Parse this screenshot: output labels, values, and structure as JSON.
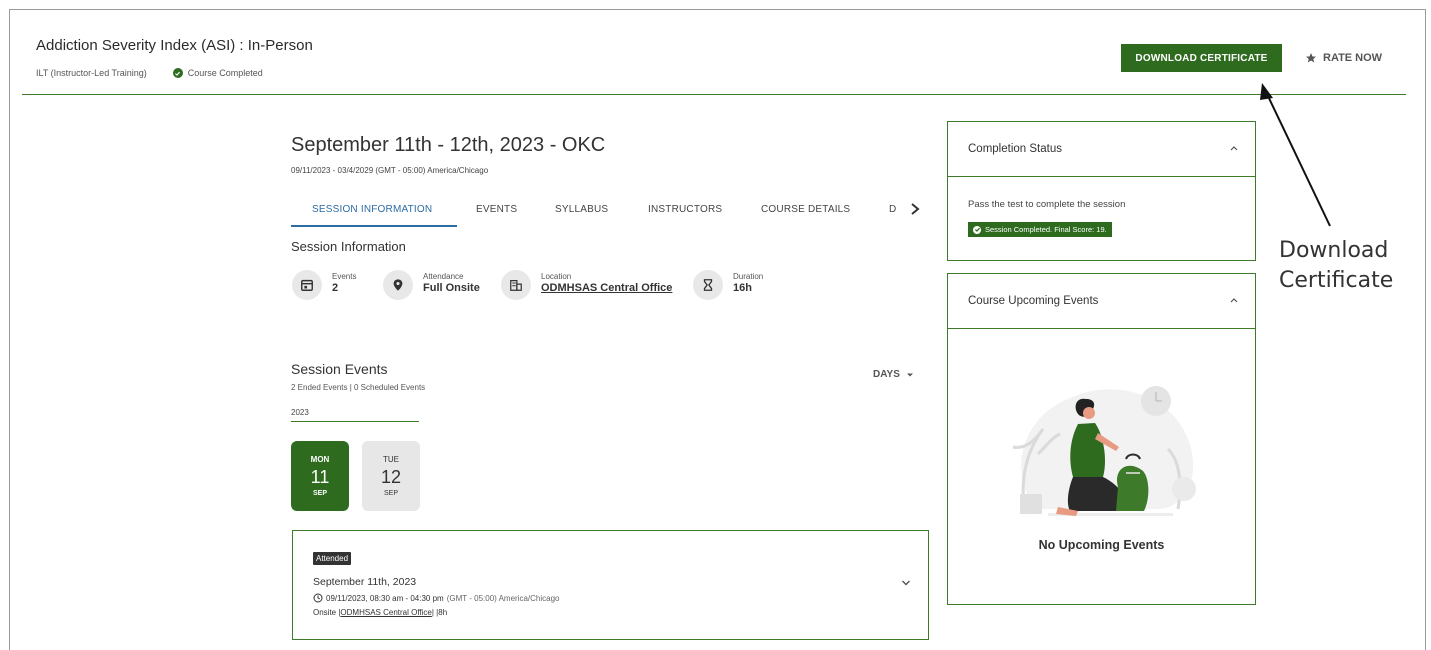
{
  "header": {
    "title": "Addiction Severity Index (ASI) : In-Person",
    "type": "ILT (Instructor-Led Training)",
    "status": "Course Completed",
    "download_label": "DOWNLOAD CERTIFICATE",
    "rate_label": "RATE NOW"
  },
  "annotation": {
    "line1": "Download",
    "line2": "Certificate"
  },
  "session": {
    "title": "September 11th - 12th, 2023 - OKC",
    "dates": "09/11/2023 - 03/4/2029 (GMT - 05:00) America/Chicago",
    "tabs": [
      {
        "label": "SESSION INFORMATION"
      },
      {
        "label": "EVENTS"
      },
      {
        "label": "SYLLABUS"
      },
      {
        "label": "INSTRUCTORS"
      },
      {
        "label": "COURSE DETAILS"
      },
      {
        "label": "D"
      }
    ],
    "section_label": "Session Information",
    "stats": {
      "events": {
        "label": "Events",
        "value": "2"
      },
      "attendance": {
        "label": "Attendance",
        "value": "Full Onsite"
      },
      "location": {
        "label": "Location",
        "value": "ODMHSAS Central Office"
      },
      "duration": {
        "label": "Duration",
        "value": "16h"
      }
    }
  },
  "events": {
    "title": "Session Events",
    "subtitle": "2 Ended Events | 0 Scheduled Events",
    "view": "DAYS",
    "year": "2023",
    "days": [
      {
        "dow": "MON",
        "num": "11",
        "mon": "SEP"
      },
      {
        "dow": "TUE",
        "num": "12",
        "mon": "SEP"
      }
    ],
    "card": {
      "badge": "Attended",
      "date": "September 11th, 2023",
      "time": "09/11/2023, 08:30 am - 04:30 pm",
      "tz": "(GMT - 05:00) America/Chicago",
      "mode": "Onsite |",
      "location": "ODMHSAS Central Office",
      "duration": "| |8h"
    }
  },
  "completion": {
    "title": "Completion Status",
    "text": "Pass the test to complete the session",
    "badge": "Session Completed. Final Score: 19."
  },
  "upcoming": {
    "title": "Course Upcoming Events",
    "empty": "No Upcoming Events"
  },
  "colors": {
    "brand_green": "#2e6b1f",
    "tab_blue": "#2b6ca3"
  }
}
